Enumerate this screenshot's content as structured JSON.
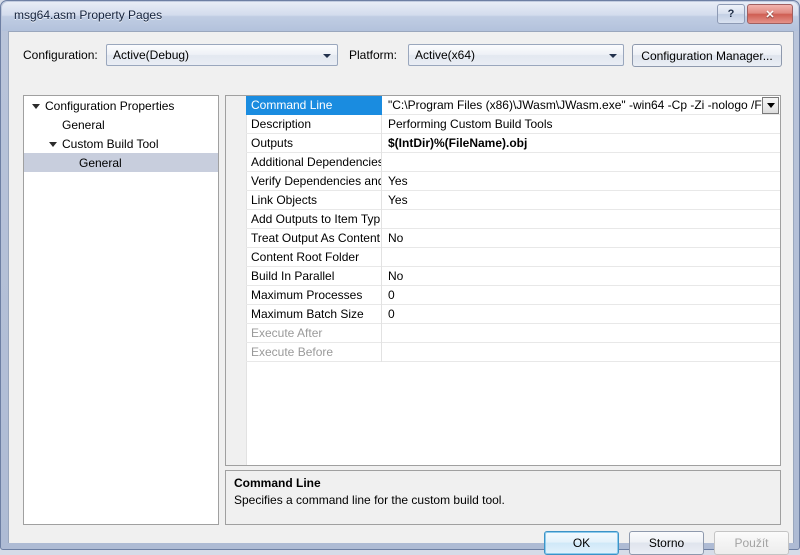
{
  "window": {
    "title": "msg64.asm Property Pages",
    "help_button": "?",
    "close_button": "✕"
  },
  "toolbar": {
    "configuration_label": "Configuration:",
    "configuration_value": "Active(Debug)",
    "platform_label": "Platform:",
    "platform_value": "Active(x64)",
    "configuration_manager_label": "Configuration Manager..."
  },
  "tree": {
    "nodes": [
      {
        "label": "Configuration Properties",
        "indent": 0,
        "expandable": true,
        "expanded": true,
        "selected": false
      },
      {
        "label": "General",
        "indent": 1,
        "expandable": false,
        "expanded": false,
        "selected": false
      },
      {
        "label": "Custom Build Tool",
        "indent": 1,
        "expandable": true,
        "expanded": true,
        "selected": false
      },
      {
        "label": "General",
        "indent": 2,
        "expandable": false,
        "expanded": false,
        "selected": true
      }
    ]
  },
  "grid": {
    "rows": [
      {
        "name": "Command Line",
        "value": "\"C:\\Program Files (x86)\\JWasm\\JWasm.exe\" -win64 -Cp -Zi -nologo /F",
        "selected": true,
        "bold": false,
        "disabled": false,
        "has_dropdown": true
      },
      {
        "name": "Description",
        "value": "Performing Custom Build Tools",
        "selected": false,
        "bold": false,
        "disabled": false,
        "has_dropdown": false
      },
      {
        "name": "Outputs",
        "value": "$(IntDir)%(FileName).obj",
        "selected": false,
        "bold": true,
        "disabled": false,
        "has_dropdown": false
      },
      {
        "name": "Additional Dependencies",
        "value": "",
        "selected": false,
        "bold": false,
        "disabled": false,
        "has_dropdown": false
      },
      {
        "name": "Verify Dependencies and",
        "value": "Yes",
        "selected": false,
        "bold": false,
        "disabled": false,
        "has_dropdown": false
      },
      {
        "name": "Link Objects",
        "value": "Yes",
        "selected": false,
        "bold": false,
        "disabled": false,
        "has_dropdown": false
      },
      {
        "name": "Add Outputs to Item Typ",
        "value": "",
        "selected": false,
        "bold": false,
        "disabled": false,
        "has_dropdown": false
      },
      {
        "name": "Treat Output As Content",
        "value": "No",
        "selected": false,
        "bold": false,
        "disabled": false,
        "has_dropdown": false
      },
      {
        "name": "Content Root Folder",
        "value": "",
        "selected": false,
        "bold": false,
        "disabled": false,
        "has_dropdown": false
      },
      {
        "name": "Build In Parallel",
        "value": "No",
        "selected": false,
        "bold": false,
        "disabled": false,
        "has_dropdown": false
      },
      {
        "name": "Maximum Processes",
        "value": "0",
        "selected": false,
        "bold": false,
        "disabled": false,
        "has_dropdown": false
      },
      {
        "name": "Maximum Batch Size",
        "value": "0",
        "selected": false,
        "bold": false,
        "disabled": false,
        "has_dropdown": false
      },
      {
        "name": "Execute After",
        "value": "",
        "selected": false,
        "bold": false,
        "disabled": true,
        "has_dropdown": false
      },
      {
        "name": "Execute Before",
        "value": "",
        "selected": false,
        "bold": false,
        "disabled": true,
        "has_dropdown": false
      }
    ]
  },
  "description": {
    "title": "Command Line",
    "text": "Specifies a command line for the custom build tool."
  },
  "footer": {
    "ok_label": "OK",
    "cancel_label": "Storno",
    "apply_label": "Použít"
  },
  "colors": {
    "selection_blue": "#1a8ce0",
    "tree_selection": "#c8cedd",
    "frame_blue": "#aebbd4",
    "close_red": "#cf5e53"
  }
}
